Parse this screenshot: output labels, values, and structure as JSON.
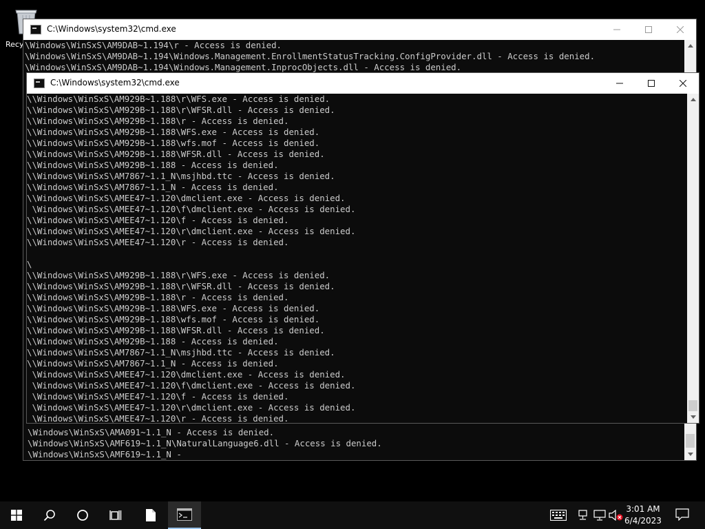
{
  "desktop": {
    "recycle_bin_label": "Recy"
  },
  "back_window": {
    "title": "C:\\Windows\\system32\\cmd.exe",
    "lines": [
      "\\Windows\\WinSxS\\AM9DAB~1.194\\r - Access is denied.",
      "\\Windows\\WinSxS\\AM9DAB~1.194\\Windows.Management.EnrollmentStatusTracking.ConfigProvider.dll - Access is denied.",
      "\\Windows\\WinSxS\\AM9DAB~1.194\\Windows.Management.InprocObjects.dll - Access is denied."
    ],
    "bottom_lines": [
      "\\Windows\\WinSxS\\AMA091~1.1_N - Access is denied.",
      "\\Windows\\WinSxS\\AMF619~1.1_N\\NaturalLanguage6.dll - Access is denied.",
      "\\Windows\\WinSxS\\AMF619~1.1_N -"
    ]
  },
  "front_window": {
    "title": "C:\\Windows\\system32\\cmd.exe",
    "lines": [
      "\\\\Windows\\WinSxS\\AM929B~1.188\\r\\WFS.exe - Access is denied.",
      "\\\\Windows\\WinSxS\\AM929B~1.188\\r\\WFSR.dll - Access is denied.",
      "\\\\Windows\\WinSxS\\AM929B~1.188\\r - Access is denied.",
      "\\\\Windows\\WinSxS\\AM929B~1.188\\WFS.exe - Access is denied.",
      "\\\\Windows\\WinSxS\\AM929B~1.188\\wfs.mof - Access is denied.",
      "\\\\Windows\\WinSxS\\AM929B~1.188\\WFSR.dll - Access is denied.",
      "\\\\Windows\\WinSxS\\AM929B~1.188 - Access is denied.",
      "\\\\Windows\\WinSxS\\AM7867~1.1_N\\msjhbd.ttc - Access is denied.",
      "\\\\Windows\\WinSxS\\AM7867~1.1_N - Access is denied.",
      "\\\\Windows\\WinSxS\\AMEE47~1.120\\dmclient.exe - Access is denied.",
      " \\Windows\\WinSxS\\AMEE47~1.120\\f\\dmclient.exe - Access is denied.",
      "\\\\Windows\\WinSxS\\AMEE47~1.120\\f - Access is denied.",
      "\\\\Windows\\WinSxS\\AMEE47~1.120\\r\\dmclient.exe - Access is denied.",
      "\\\\Windows\\WinSxS\\AMEE47~1.120\\r - Access is denied.",
      "",
      "\\",
      "\\\\Windows\\WinSxS\\AM929B~1.188\\r\\WFS.exe - Access is denied.",
      "\\\\Windows\\WinSxS\\AM929B~1.188\\r\\WFSR.dll - Access is denied.",
      "\\\\Windows\\WinSxS\\AM929B~1.188\\r - Access is denied.",
      "\\\\Windows\\WinSxS\\AM929B~1.188\\WFS.exe - Access is denied.",
      "\\\\Windows\\WinSxS\\AM929B~1.188\\wfs.mof - Access is denied.",
      "\\\\Windows\\WinSxS\\AM929B~1.188\\WFSR.dll - Access is denied.",
      "\\\\Windows\\WinSxS\\AM929B~1.188 - Access is denied.",
      "\\\\Windows\\WinSxS\\AM7867~1.1_N\\msjhbd.ttc - Access is denied.",
      "\\\\Windows\\WinSxS\\AM7867~1.1_N - Access is denied.",
      " \\Windows\\WinSxS\\AMEE47~1.120\\dmclient.exe - Access is denied.",
      " \\Windows\\WinSxS\\AMEE47~1.120\\f\\dmclient.exe - Access is denied.",
      " \\Windows\\WinSxS\\AMEE47~1.120\\f - Access is denied.",
      " \\Windows\\WinSxS\\AMEE47~1.120\\r\\dmclient.exe - Access is denied.",
      " \\Windows\\WinSxS\\AMEE47~1.120\\r - Access is denied."
    ]
  },
  "taskbar": {
    "time": "3:01 AM",
    "date": "6/4/2023",
    "icons": [
      "windows-start-icon",
      "search-icon",
      "cortana-icon",
      "task-view-icon",
      "file-icon",
      "cmd-icon"
    ],
    "tray_icons": [
      "keyboard-icon",
      "network-icon",
      "display-icon",
      "volume-muted-icon",
      "notification-icon"
    ]
  }
}
